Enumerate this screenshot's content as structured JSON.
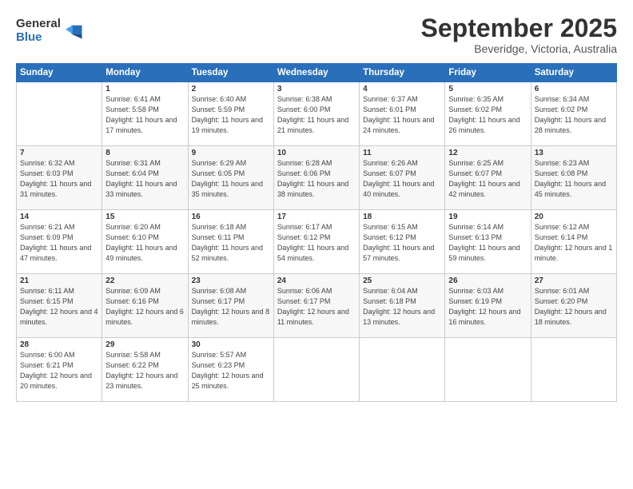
{
  "logo": {
    "general": "General",
    "blue": "Blue"
  },
  "title": "September 2025",
  "location": "Beveridge, Victoria, Australia",
  "days": [
    "Sunday",
    "Monday",
    "Tuesday",
    "Wednesday",
    "Thursday",
    "Friday",
    "Saturday"
  ],
  "weeks": [
    [
      {
        "date": "",
        "sunrise": "",
        "sunset": "",
        "daylight": ""
      },
      {
        "date": "1",
        "sunrise": "Sunrise: 6:41 AM",
        "sunset": "Sunset: 5:58 PM",
        "daylight": "Daylight: 11 hours and 17 minutes."
      },
      {
        "date": "2",
        "sunrise": "Sunrise: 6:40 AM",
        "sunset": "Sunset: 5:59 PM",
        "daylight": "Daylight: 11 hours and 19 minutes."
      },
      {
        "date": "3",
        "sunrise": "Sunrise: 6:38 AM",
        "sunset": "Sunset: 6:00 PM",
        "daylight": "Daylight: 11 hours and 21 minutes."
      },
      {
        "date": "4",
        "sunrise": "Sunrise: 6:37 AM",
        "sunset": "Sunset: 6:01 PM",
        "daylight": "Daylight: 11 hours and 24 minutes."
      },
      {
        "date": "5",
        "sunrise": "Sunrise: 6:35 AM",
        "sunset": "Sunset: 6:02 PM",
        "daylight": "Daylight: 11 hours and 26 minutes."
      },
      {
        "date": "6",
        "sunrise": "Sunrise: 6:34 AM",
        "sunset": "Sunset: 6:02 PM",
        "daylight": "Daylight: 11 hours and 28 minutes."
      }
    ],
    [
      {
        "date": "7",
        "sunrise": "Sunrise: 6:32 AM",
        "sunset": "Sunset: 6:03 PM",
        "daylight": "Daylight: 11 hours and 31 minutes."
      },
      {
        "date": "8",
        "sunrise": "Sunrise: 6:31 AM",
        "sunset": "Sunset: 6:04 PM",
        "daylight": "Daylight: 11 hours and 33 minutes."
      },
      {
        "date": "9",
        "sunrise": "Sunrise: 6:29 AM",
        "sunset": "Sunset: 6:05 PM",
        "daylight": "Daylight: 11 hours and 35 minutes."
      },
      {
        "date": "10",
        "sunrise": "Sunrise: 6:28 AM",
        "sunset": "Sunset: 6:06 PM",
        "daylight": "Daylight: 11 hours and 38 minutes."
      },
      {
        "date": "11",
        "sunrise": "Sunrise: 6:26 AM",
        "sunset": "Sunset: 6:07 PM",
        "daylight": "Daylight: 11 hours and 40 minutes."
      },
      {
        "date": "12",
        "sunrise": "Sunrise: 6:25 AM",
        "sunset": "Sunset: 6:07 PM",
        "daylight": "Daylight: 11 hours and 42 minutes."
      },
      {
        "date": "13",
        "sunrise": "Sunrise: 6:23 AM",
        "sunset": "Sunset: 6:08 PM",
        "daylight": "Daylight: 11 hours and 45 minutes."
      }
    ],
    [
      {
        "date": "14",
        "sunrise": "Sunrise: 6:21 AM",
        "sunset": "Sunset: 6:09 PM",
        "daylight": "Daylight: 11 hours and 47 minutes."
      },
      {
        "date": "15",
        "sunrise": "Sunrise: 6:20 AM",
        "sunset": "Sunset: 6:10 PM",
        "daylight": "Daylight: 11 hours and 49 minutes."
      },
      {
        "date": "16",
        "sunrise": "Sunrise: 6:18 AM",
        "sunset": "Sunset: 6:11 PM",
        "daylight": "Daylight: 11 hours and 52 minutes."
      },
      {
        "date": "17",
        "sunrise": "Sunrise: 6:17 AM",
        "sunset": "Sunset: 6:12 PM",
        "daylight": "Daylight: 11 hours and 54 minutes."
      },
      {
        "date": "18",
        "sunrise": "Sunrise: 6:15 AM",
        "sunset": "Sunset: 6:12 PM",
        "daylight": "Daylight: 11 hours and 57 minutes."
      },
      {
        "date": "19",
        "sunrise": "Sunrise: 6:14 AM",
        "sunset": "Sunset: 6:13 PM",
        "daylight": "Daylight: 11 hours and 59 minutes."
      },
      {
        "date": "20",
        "sunrise": "Sunrise: 6:12 AM",
        "sunset": "Sunset: 6:14 PM",
        "daylight": "Daylight: 12 hours and 1 minute."
      }
    ],
    [
      {
        "date": "21",
        "sunrise": "Sunrise: 6:11 AM",
        "sunset": "Sunset: 6:15 PM",
        "daylight": "Daylight: 12 hours and 4 minutes."
      },
      {
        "date": "22",
        "sunrise": "Sunrise: 6:09 AM",
        "sunset": "Sunset: 6:16 PM",
        "daylight": "Daylight: 12 hours and 6 minutes."
      },
      {
        "date": "23",
        "sunrise": "Sunrise: 6:08 AM",
        "sunset": "Sunset: 6:17 PM",
        "daylight": "Daylight: 12 hours and 8 minutes."
      },
      {
        "date": "24",
        "sunrise": "Sunrise: 6:06 AM",
        "sunset": "Sunset: 6:17 PM",
        "daylight": "Daylight: 12 hours and 11 minutes."
      },
      {
        "date": "25",
        "sunrise": "Sunrise: 6:04 AM",
        "sunset": "Sunset: 6:18 PM",
        "daylight": "Daylight: 12 hours and 13 minutes."
      },
      {
        "date": "26",
        "sunrise": "Sunrise: 6:03 AM",
        "sunset": "Sunset: 6:19 PM",
        "daylight": "Daylight: 12 hours and 16 minutes."
      },
      {
        "date": "27",
        "sunrise": "Sunrise: 6:01 AM",
        "sunset": "Sunset: 6:20 PM",
        "daylight": "Daylight: 12 hours and 18 minutes."
      }
    ],
    [
      {
        "date": "28",
        "sunrise": "Sunrise: 6:00 AM",
        "sunset": "Sunset: 6:21 PM",
        "daylight": "Daylight: 12 hours and 20 minutes."
      },
      {
        "date": "29",
        "sunrise": "Sunrise: 5:58 AM",
        "sunset": "Sunset: 6:22 PM",
        "daylight": "Daylight: 12 hours and 23 minutes."
      },
      {
        "date": "30",
        "sunrise": "Sunrise: 5:57 AM",
        "sunset": "Sunset: 6:23 PM",
        "daylight": "Daylight: 12 hours and 25 minutes."
      },
      {
        "date": "",
        "sunrise": "",
        "sunset": "",
        "daylight": ""
      },
      {
        "date": "",
        "sunrise": "",
        "sunset": "",
        "daylight": ""
      },
      {
        "date": "",
        "sunrise": "",
        "sunset": "",
        "daylight": ""
      },
      {
        "date": "",
        "sunrise": "",
        "sunset": "",
        "daylight": ""
      }
    ]
  ]
}
